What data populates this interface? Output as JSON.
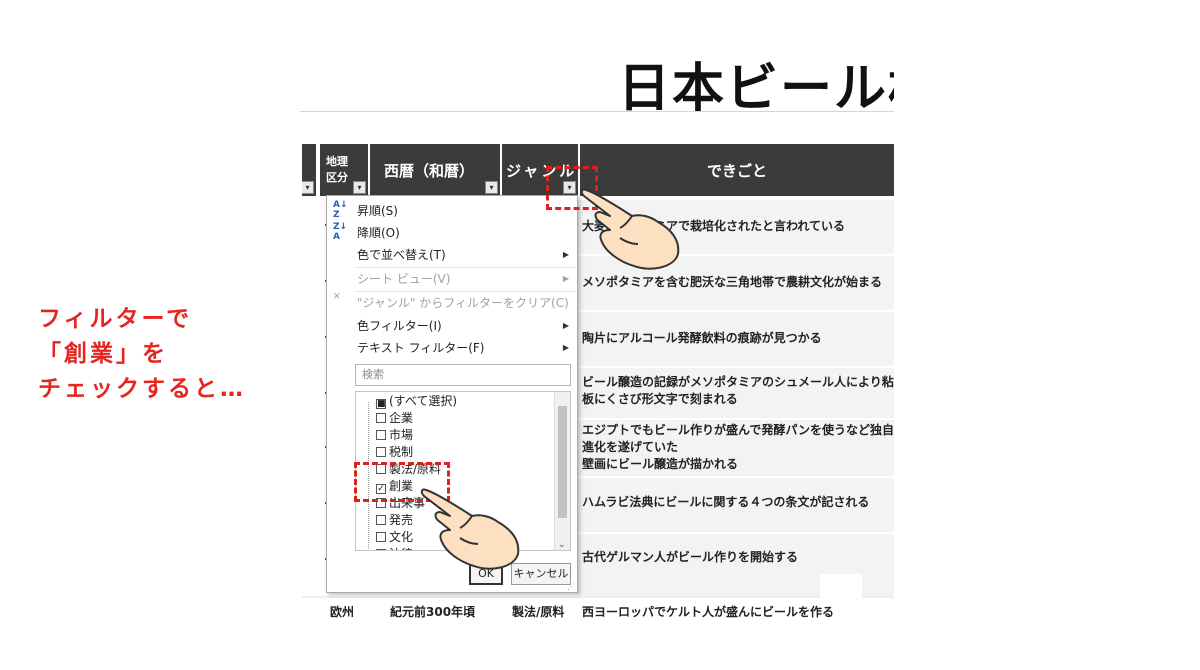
{
  "page": {
    "title": "日本ビール格"
  },
  "headers": {
    "region": "地理区分",
    "year": "西暦（和暦）",
    "genre": "ジャンル",
    "event": "できごと"
  },
  "events": [
    "大麦…ゾポタミアで栽培化されたと言われている",
    "メソポタミアを含む肥沃な三角地帯で農耕文化が始まる",
    "陶片にアルコール発酵飲料の痕跡が見つかる",
    "ビール醸造の記録がメソポタミアのシュメール人により粘",
    "板にくさび形文字で刻まれる",
    "エジプトでもビール作りが盛んで発酵パンを使うなど独自",
    "進化を遂げていた",
    "壁画にビール醸造が描かれる",
    "ハムラビ法典にビールに関する４つの条文が記される",
    "古代ゲルマン人がビール作りを開始する"
  ],
  "bottom_row": {
    "region": "欧州",
    "year": "紀元前300年頃",
    "genre": "製法/原料",
    "event": "西ヨーロッパでケルト人が盛んにビールを作る"
  },
  "filter_menu": {
    "sort_asc": "昇順(S)",
    "sort_desc": "降順(O)",
    "sort_by_color": "色で並べ替え(T)",
    "sheet_view": "シート ビュー(V)",
    "clear_filter": "\"ジャンル\" からフィルターをクリア(C)",
    "color_filter": "色フィルター(I)",
    "text_filter": "テキスト フィルター(F)",
    "search_placeholder": "検索",
    "items": [
      {
        "label": "(すべて選択)",
        "state": "partial"
      },
      {
        "label": "企業",
        "state": "unchecked"
      },
      {
        "label": "市場",
        "state": "unchecked"
      },
      {
        "label": "税制",
        "state": "unchecked"
      },
      {
        "label": "製法/原料",
        "state": "unchecked"
      },
      {
        "label": "創業",
        "state": "checked"
      },
      {
        "label": "出来事",
        "state": "unchecked"
      },
      {
        "label": "発売",
        "state": "unchecked"
      },
      {
        "label": "文化",
        "state": "unchecked"
      },
      {
        "label": "法律",
        "state": "unchecked"
      }
    ],
    "ok": "OK",
    "cancel": "キャンセル"
  },
  "annotation": {
    "line1": "フィルターで",
    "line2": "「創業」を",
    "line3": "チェックすると…"
  },
  "colors": {
    "header_bg": "#3b3b3b",
    "accent_red": "#e52620",
    "row_bg": "#f3f3f3"
  }
}
